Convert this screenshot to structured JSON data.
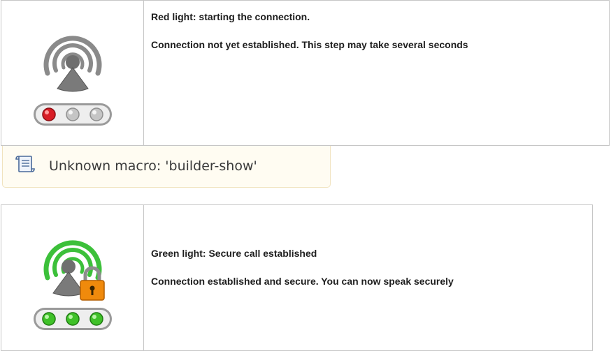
{
  "rows": [
    {
      "state": "red",
      "title": "Red light: starting the connection.",
      "description": "Connection not yet established. This step may take several seconds",
      "icon": "connecting-signal-icon",
      "lights": [
        "red",
        "gray",
        "gray"
      ],
      "colors": {
        "arcs": "#8a8a8a",
        "led_on": "#d81d25",
        "led_off": "#c5c5c5"
      }
    },
    {
      "state": "green",
      "title": "Green light: Secure call established",
      "description": "Connection established and secure. You can now speak securely",
      "icon": "secure-signal-lock-icon",
      "lights": [
        "green",
        "green",
        "green"
      ],
      "colors": {
        "arcs": "#3cc03a",
        "led_on": "#3fc128",
        "lock": "#f08a0c"
      }
    }
  ],
  "macro_error": {
    "text": "Unknown macro: 'builder-show'",
    "icon": "scroll-document-icon"
  }
}
